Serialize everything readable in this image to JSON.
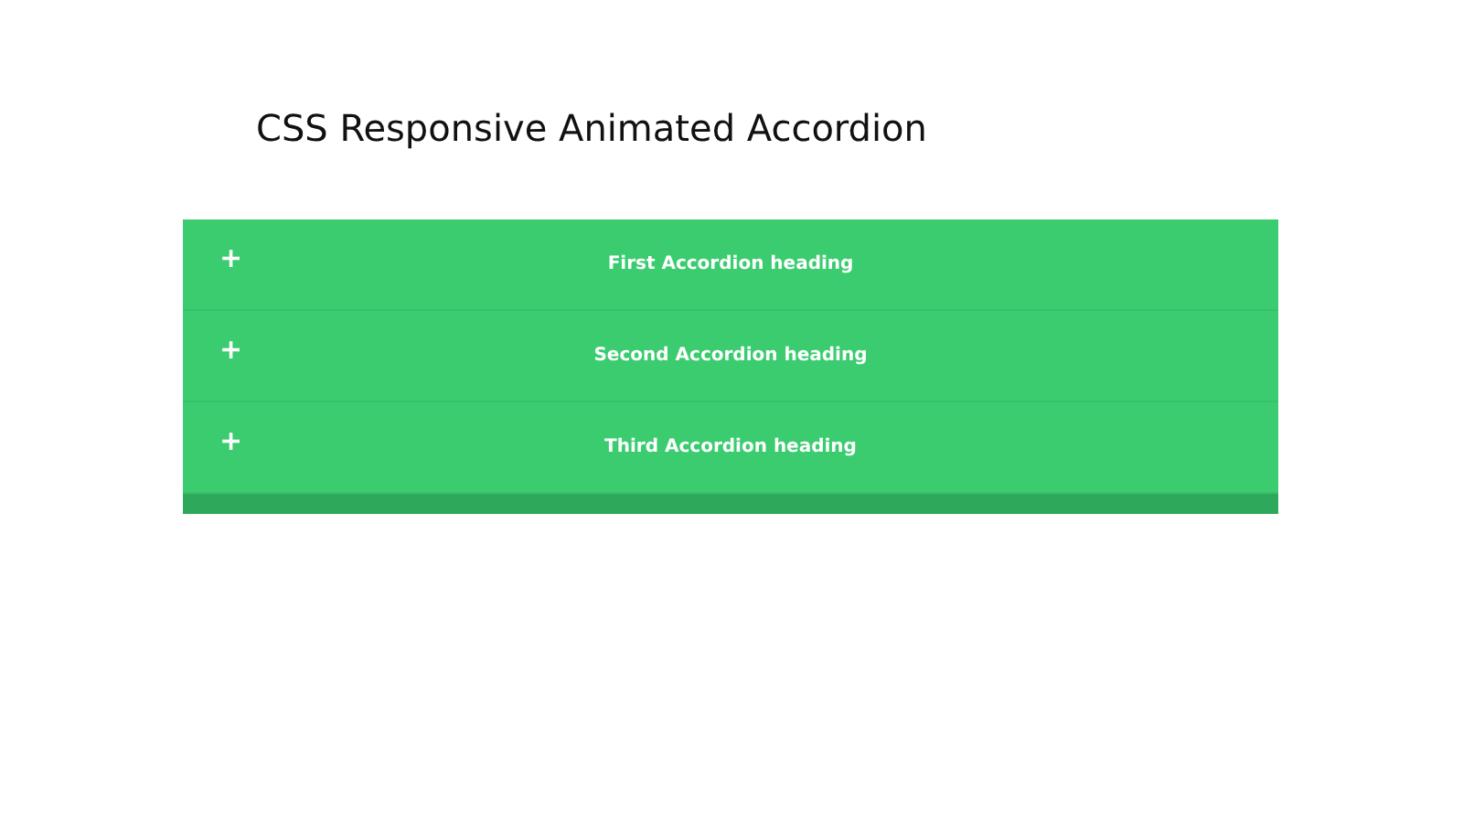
{
  "title": "CSS Responsive Animated Accordion",
  "accordion": [
    {
      "icon": "+",
      "heading": "First Accordion heading",
      "expanded": false
    },
    {
      "icon": "+",
      "heading": "Second Accordion heading",
      "expanded": false
    },
    {
      "icon": "+",
      "heading": "Third Accordion heading",
      "expanded": false
    }
  ]
}
